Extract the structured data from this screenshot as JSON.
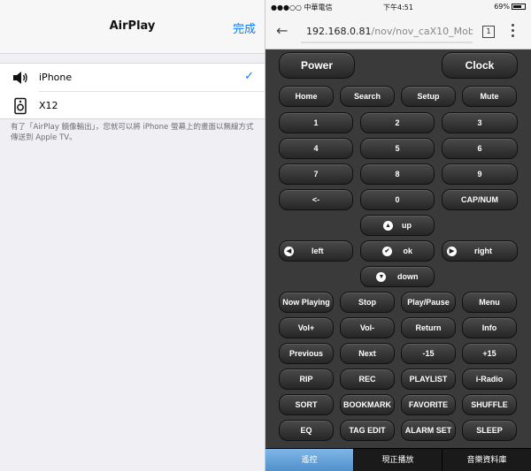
{
  "airplay": {
    "title": "AirPlay",
    "done_label": "完成",
    "devices": [
      {
        "label": "iPhone",
        "icon": "speaker-icon",
        "selected": true
      },
      {
        "label": "X12",
        "icon": "speaker-box-icon",
        "selected": false
      }
    ],
    "checkmark": "✓",
    "note": "有了「AirPlay 鏡像輸出」，您就可以將 iPhone 螢幕上的畫面以無線方式傳送到 Apple TV。"
  },
  "statusbar": {
    "carrier": "●●●○○ 中華電信",
    "time": "下午4:51",
    "battery": "69%"
  },
  "browser": {
    "back": "←",
    "url_host": "192.168.0.81",
    "url_path": "/nov/nov_caX10_Mob",
    "tab_count": "1"
  },
  "remote": {
    "power": "Power",
    "clock": "Clock",
    "row1": [
      "Home",
      "Search",
      "Setup",
      "Mute"
    ],
    "numpad": [
      "1",
      "2",
      "3",
      "4",
      "5",
      "6",
      "7",
      "8",
      "9",
      "<-",
      "0",
      "CAP/NUM"
    ],
    "nav": {
      "up": "up",
      "left": "left",
      "ok": "ok",
      "right": "right",
      "down": "down"
    },
    "grid": [
      [
        "Now Playing",
        "Stop",
        "Play/Pause",
        "Menu"
      ],
      [
        "Vol+",
        "Vol-",
        "Return",
        "Info"
      ],
      [
        "Previous",
        "Next",
        "-15",
        "+15"
      ],
      [
        "RIP",
        "REC",
        "PLAYLIST",
        "i-Radio"
      ],
      [
        "SORT",
        "BOOKMARK",
        "FAVORITE",
        "SHUFFLE"
      ],
      [
        "EQ",
        "TAG EDIT",
        "ALARM SET",
        "SLEEP"
      ]
    ]
  },
  "bottom_tabs": [
    "遙控",
    "現正播放",
    "音樂資料庫"
  ],
  "colors": {
    "accent": "#0a7aff",
    "active_tab": "#5b9bd5"
  }
}
